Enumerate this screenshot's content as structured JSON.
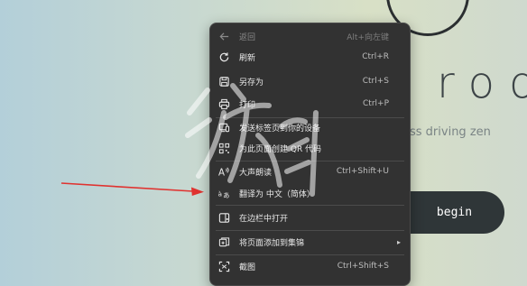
{
  "background": {
    "hero_title": "roo",
    "hero_subtitle": "ss driving zen",
    "begin_label": "begin"
  },
  "menu": {
    "items": [
      {
        "label": "返回",
        "shortcut": "Alt+向左键",
        "icon": "back-arrow-icon",
        "disabled": true
      },
      {
        "label": "刷新",
        "shortcut": "Ctrl+R",
        "icon": "refresh-icon"
      },
      {
        "label": "另存为",
        "shortcut": "Ctrl+S",
        "icon": "save-as-icon"
      },
      {
        "label": "打印",
        "shortcut": "Ctrl+P",
        "icon": "print-icon"
      },
      {
        "label": "发送标签页到你的设备",
        "shortcut": "",
        "icon": "send-to-device-icon"
      },
      {
        "label": "为此页面创建 QR 代码",
        "shortcut": "",
        "icon": "qr-code-icon"
      },
      {
        "label": "大声朗读",
        "shortcut": "Ctrl+Shift+U",
        "icon": "read-aloud-icon"
      },
      {
        "label": "翻译为 中文（简体）",
        "shortcut": "",
        "icon": "translate-icon"
      },
      {
        "label": "在边栏中打开",
        "shortcut": "",
        "icon": "sidebar-icon"
      },
      {
        "label": "将页面添加到集锦",
        "shortcut": "",
        "icon": "collections-icon",
        "submenu": true
      },
      {
        "label": "截图",
        "shortcut": "Ctrl+Shift+S",
        "icon": "screenshot-icon"
      }
    ]
  },
  "watermark": {
    "text": "游侠网"
  },
  "colors": {
    "menu_bg": "#323232",
    "arrow": "#e0322f",
    "button_bg": "#2f3638"
  }
}
